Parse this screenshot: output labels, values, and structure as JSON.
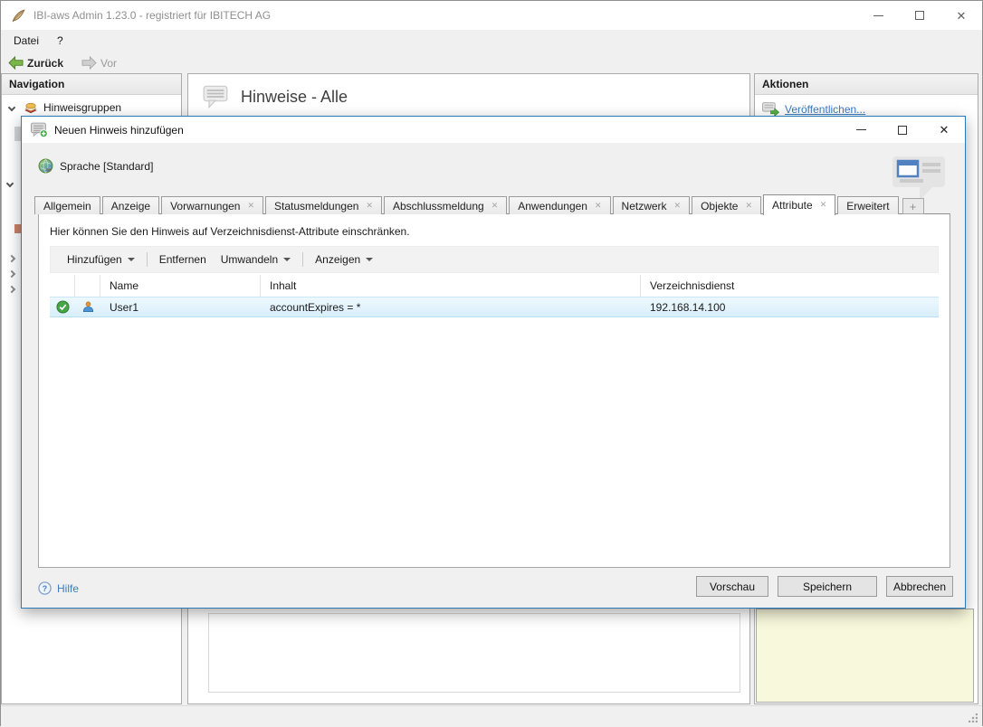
{
  "colors": {
    "dialog_border": "#2a7ab9",
    "link": "#3b7bbf",
    "selected_row_top": "#edf8fe",
    "selected_row_bottom": "#d9effb",
    "notes_panel": "#f8f8dc",
    "back_arrow_green": "#7ab648",
    "status_ok_green": "#47a447"
  },
  "window": {
    "titlebar": {
      "title": "IBI-aws Admin 1.23.0 - registriert für IBITECH AG"
    },
    "menu": {
      "items": [
        {
          "label": "Datei"
        },
        {
          "label": "?"
        }
      ]
    },
    "toolbar": {
      "back_label": "Zurück",
      "forward_label": "Vor"
    },
    "navigation": {
      "header": "Navigation",
      "tree": [
        {
          "label": "Hinweisgruppen"
        }
      ]
    },
    "main": {
      "title": "Hinweise - Alle"
    },
    "actions": {
      "header": "Aktionen",
      "publish_label": "Veröffentlichen..."
    }
  },
  "dialog": {
    "title": "Neuen Hinweis hinzufügen",
    "language_label": "Sprache [Standard]",
    "tabs": [
      {
        "label": "Allgemein",
        "closable": false,
        "active": false
      },
      {
        "label": "Anzeige",
        "closable": false,
        "active": false
      },
      {
        "label": "Vorwarnungen",
        "closable": true,
        "active": false
      },
      {
        "label": "Statusmeldungen",
        "closable": true,
        "active": false
      },
      {
        "label": "Abschlussmeldung",
        "closable": true,
        "active": false
      },
      {
        "label": "Anwendungen",
        "closable": true,
        "active": false
      },
      {
        "label": "Netzwerk",
        "closable": true,
        "active": false
      },
      {
        "label": "Objekte",
        "closable": true,
        "active": false
      },
      {
        "label": "Attribute",
        "closable": true,
        "active": true
      },
      {
        "label": "Erweitert",
        "closable": false,
        "active": false
      }
    ],
    "new_tab_label": "+",
    "instruction": "Hier können Sie den Hinweis auf Verzeichnisdienst-Attribute einschränken.",
    "toolbar": {
      "add_label": "Hinzufügen",
      "remove_label": "Entfernen",
      "convert_label": "Umwandeln",
      "show_label": "Anzeigen"
    },
    "table": {
      "columns": [
        {
          "label": "Name"
        },
        {
          "label": "Inhalt"
        },
        {
          "label": "Verzeichnisdienst"
        }
      ],
      "rows": [
        {
          "status_icon": "green-check",
          "type_icon": "user",
          "name": "User1",
          "content": "accountExpires = *",
          "directory": "192.168.14.100"
        }
      ]
    },
    "footer": {
      "help_label": "Hilfe",
      "preview_label": "Vorschau",
      "save_label": "Speichern",
      "cancel_label": "Abbrechen"
    }
  }
}
